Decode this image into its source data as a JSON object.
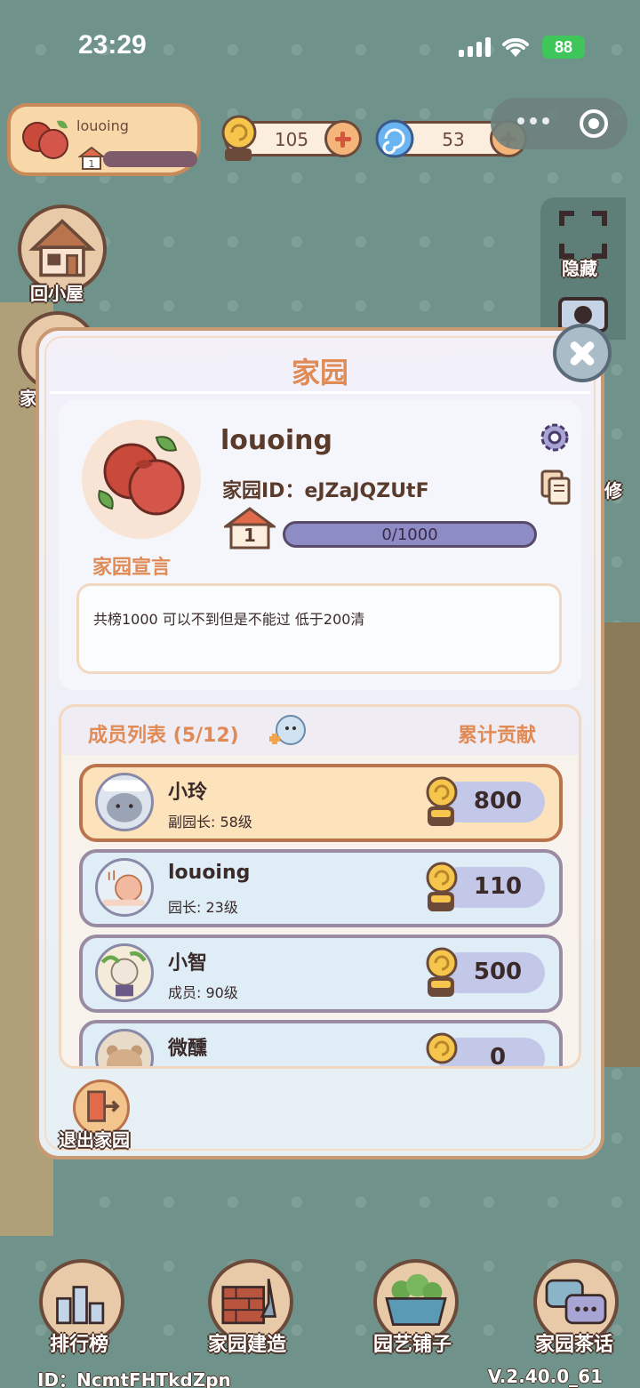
{
  "status_bar": {
    "time": "23:29",
    "battery": "88"
  },
  "profile": {
    "name": "louoing",
    "level": "1"
  },
  "currencies": {
    "snail_coins": "105",
    "gems": "53"
  },
  "side_buttons": {
    "home": "回小屋",
    "hide": "隐藏",
    "garden_partial": "家",
    "repair_partial": "修"
  },
  "modal": {
    "title": "家园",
    "garden_name": "louoing",
    "garden_id_label": "家园ID：",
    "garden_id": "eJZaJQZUtF",
    "level": "1",
    "progress_text": "0/1000",
    "progress_fraction": 0.0,
    "declaration_label": "家园宣言",
    "declaration": "共榜1000 可以不到但是不能过 低于200清",
    "members_title": "成员列表 (5/12)",
    "contribution_title": "累计贡献",
    "members": [
      {
        "name": "小玲",
        "role": "副园长: 58级",
        "contribution": "800"
      },
      {
        "name": "louoing",
        "role": "园长: 23级",
        "contribution": "110"
      },
      {
        "name": "小智",
        "role": "成员: 90级",
        "contribution": "500"
      },
      {
        "name": "微醺",
        "role": "",
        "contribution": "0"
      }
    ],
    "exit_label": "退出家园"
  },
  "bottom_nav": {
    "ranking": "排行榜",
    "build": "家园建造",
    "shop": "园艺铺子",
    "chat": "家园茶话"
  },
  "footer": {
    "user_id": "ID：NcmtFHTkdZpn",
    "version": "V.2.40.0_61"
  },
  "colors": {
    "accent": "#e08a56",
    "background": "#6f938a",
    "highlight_row": "#fde3bc"
  }
}
